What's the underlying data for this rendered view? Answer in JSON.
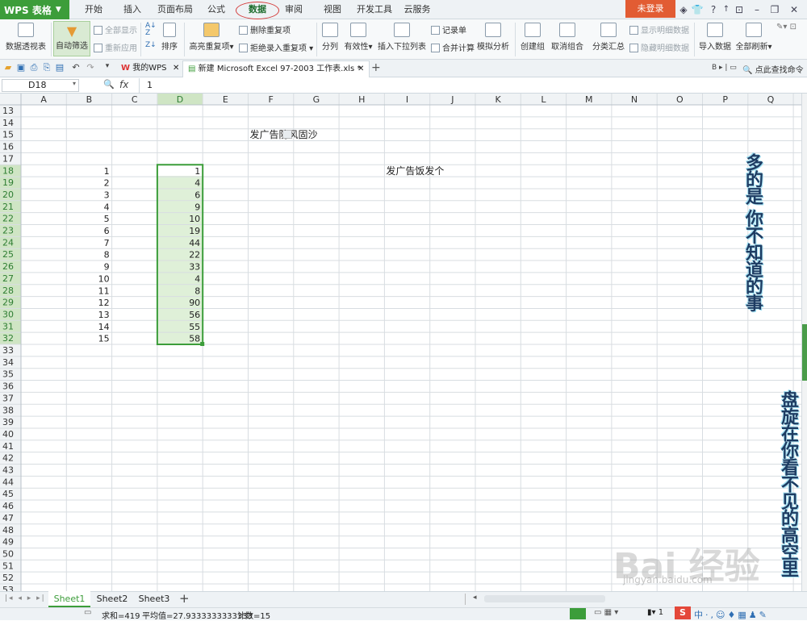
{
  "app": {
    "logo": "WPS 表格"
  },
  "menu_tabs": [
    "开始",
    "插入",
    "页面布局",
    "公式",
    "数据",
    "审阅",
    "视图",
    "开发工具",
    "云服务"
  ],
  "login": "未登录",
  "ribbon": {
    "pivot": "数据透视表",
    "autofilter": "自动筛选",
    "show_all": "全部显示",
    "reapply": "重新应用",
    "sort": "排序",
    "highlight_dup": "高亮重复项",
    "remove_dup": "删除重复项",
    "reject_dup": "拒绝录入重复项",
    "split": "分列",
    "validity": "有效性",
    "dropdown_list": "插入下拉列表",
    "record": "记录单",
    "consolidate": "合并计算",
    "what_if": "模拟分析",
    "group": "创建组",
    "ungroup": "取消组合",
    "subtotal": "分类汇总",
    "show_detail": "显示明细数据",
    "hide_detail": "隐藏明细数据",
    "import": "导入数据",
    "refresh_all": "全部刷新"
  },
  "docbar": {
    "my_wps": "我的WPS",
    "file_tab": "新建 Microsoft Excel 97-2003 工作表.xls *",
    "find_command": "点此查找命令"
  },
  "formula": {
    "name_box": "D18",
    "fx": "fx",
    "value": "1"
  },
  "grid": {
    "columns": [
      "A",
      "B",
      "C",
      "D",
      "E",
      "F",
      "G",
      "H",
      "I",
      "J",
      "K",
      "L",
      "M",
      "N",
      "O",
      "P",
      "Q"
    ],
    "first_row": 13,
    "b_values": [
      "1",
      "2",
      "3",
      "4",
      "5",
      "6",
      "7",
      "8",
      "9",
      "10",
      "11",
      "12",
      "13",
      "14",
      "15"
    ],
    "d_values": [
      "1",
      "4",
      "6",
      "9",
      "10",
      "19",
      "44",
      "22",
      "33",
      "4",
      "8",
      "90",
      "56",
      "55",
      "58"
    ],
    "f15_text": "发广告防风固沙",
    "i18_text": "发广告饭发个"
  },
  "overlay": {
    "text1": "多的是 你不知道的事",
    "text2": "盘旋在你看不见的高空里",
    "watermark": "Bai 经验",
    "watermark_url": "jingyan.baidu.com"
  },
  "sheets": [
    "Sheet1",
    "Sheet2",
    "Sheet3"
  ],
  "status": {
    "sum": "求和=419",
    "avg": "平均值=27.9333333333333",
    "count": "计数=15",
    "zoom": "1"
  }
}
